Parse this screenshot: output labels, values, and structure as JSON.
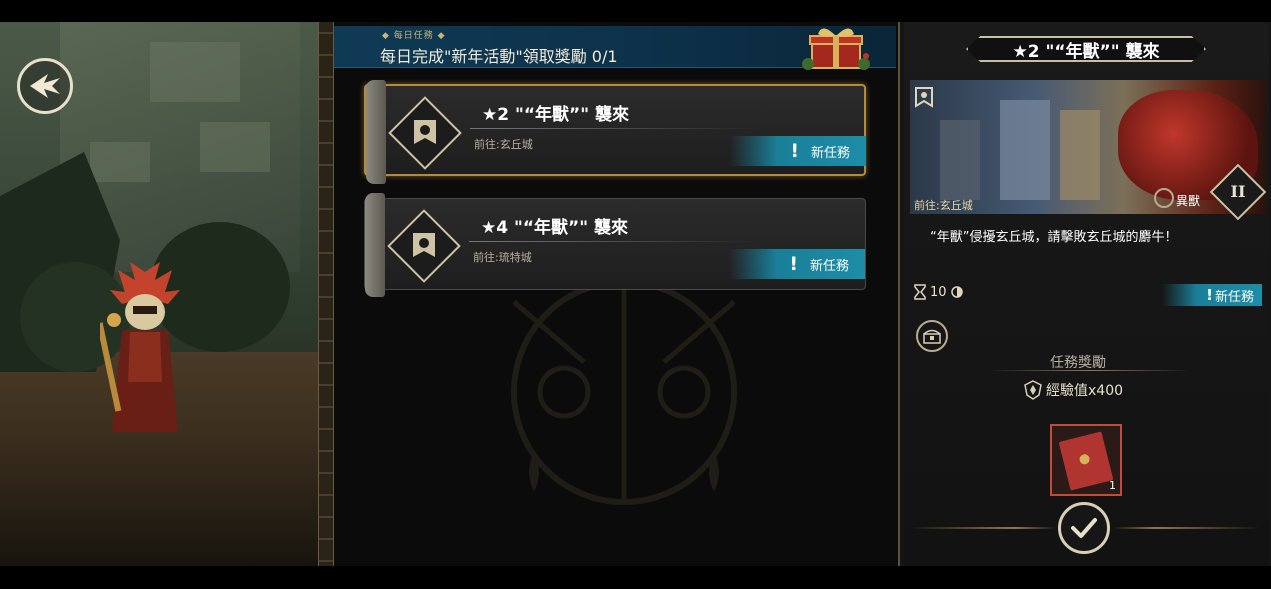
{
  "daily_task": {
    "tag": "◆ 每日任務 ◆",
    "text": "每日完成\"新年活動\"領取獎勵 0/1"
  },
  "quests": [
    {
      "title": "★2 \"“年獸”\" 襲來",
      "location": "前往:玄丘城",
      "status": "新任務",
      "selected": true
    },
    {
      "title": "★4 \"“年獸”\" 襲來",
      "location": "前往:琉特城",
      "status": "新任務",
      "selected": false
    }
  ],
  "detail": {
    "header": "★2 \"“年獸”\" 襲來",
    "location": "前往:玄丘城",
    "type": "異獸",
    "rank": "II",
    "description": "“年獸”侵擾玄丘城，請擊敗玄丘城的麝牛！",
    "timer": "10",
    "status": "新任務",
    "reward_title": "任務獎勵",
    "exp_reward": "經驗值x400",
    "item_qty": "1"
  },
  "colors": {
    "badge_teal": "#1d8da8",
    "gold_accent": "#b48a3e",
    "daily_blue": "#0f3a55"
  }
}
